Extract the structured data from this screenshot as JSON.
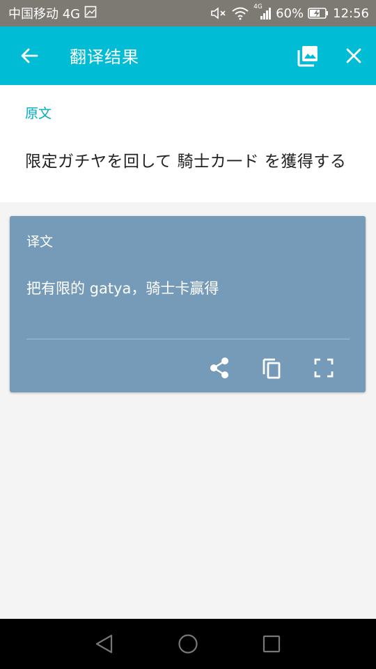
{
  "status_bar": {
    "carrier": "中国移动 4G",
    "battery": "60%",
    "time": "12:56",
    "network_badge": "4G"
  },
  "app_bar": {
    "title": "翻译结果",
    "icons": [
      "back-arrow-icon",
      "gallery-icon",
      "close-icon"
    ]
  },
  "source": {
    "label": "原文",
    "text": "限定ガチヤを回して 騎士カ一ド を獲得する"
  },
  "translation": {
    "label": "译文",
    "text": "把有限的 gatya，骑士卡赢得",
    "actions": [
      "share-icon",
      "copy-icon",
      "fullscreen-icon"
    ]
  },
  "colors": {
    "status_bar": "#7d7a73",
    "app_bar": "#00bcd4",
    "accent": "#00acc1",
    "card": "#769bb8",
    "background": "#f4f4f4"
  }
}
